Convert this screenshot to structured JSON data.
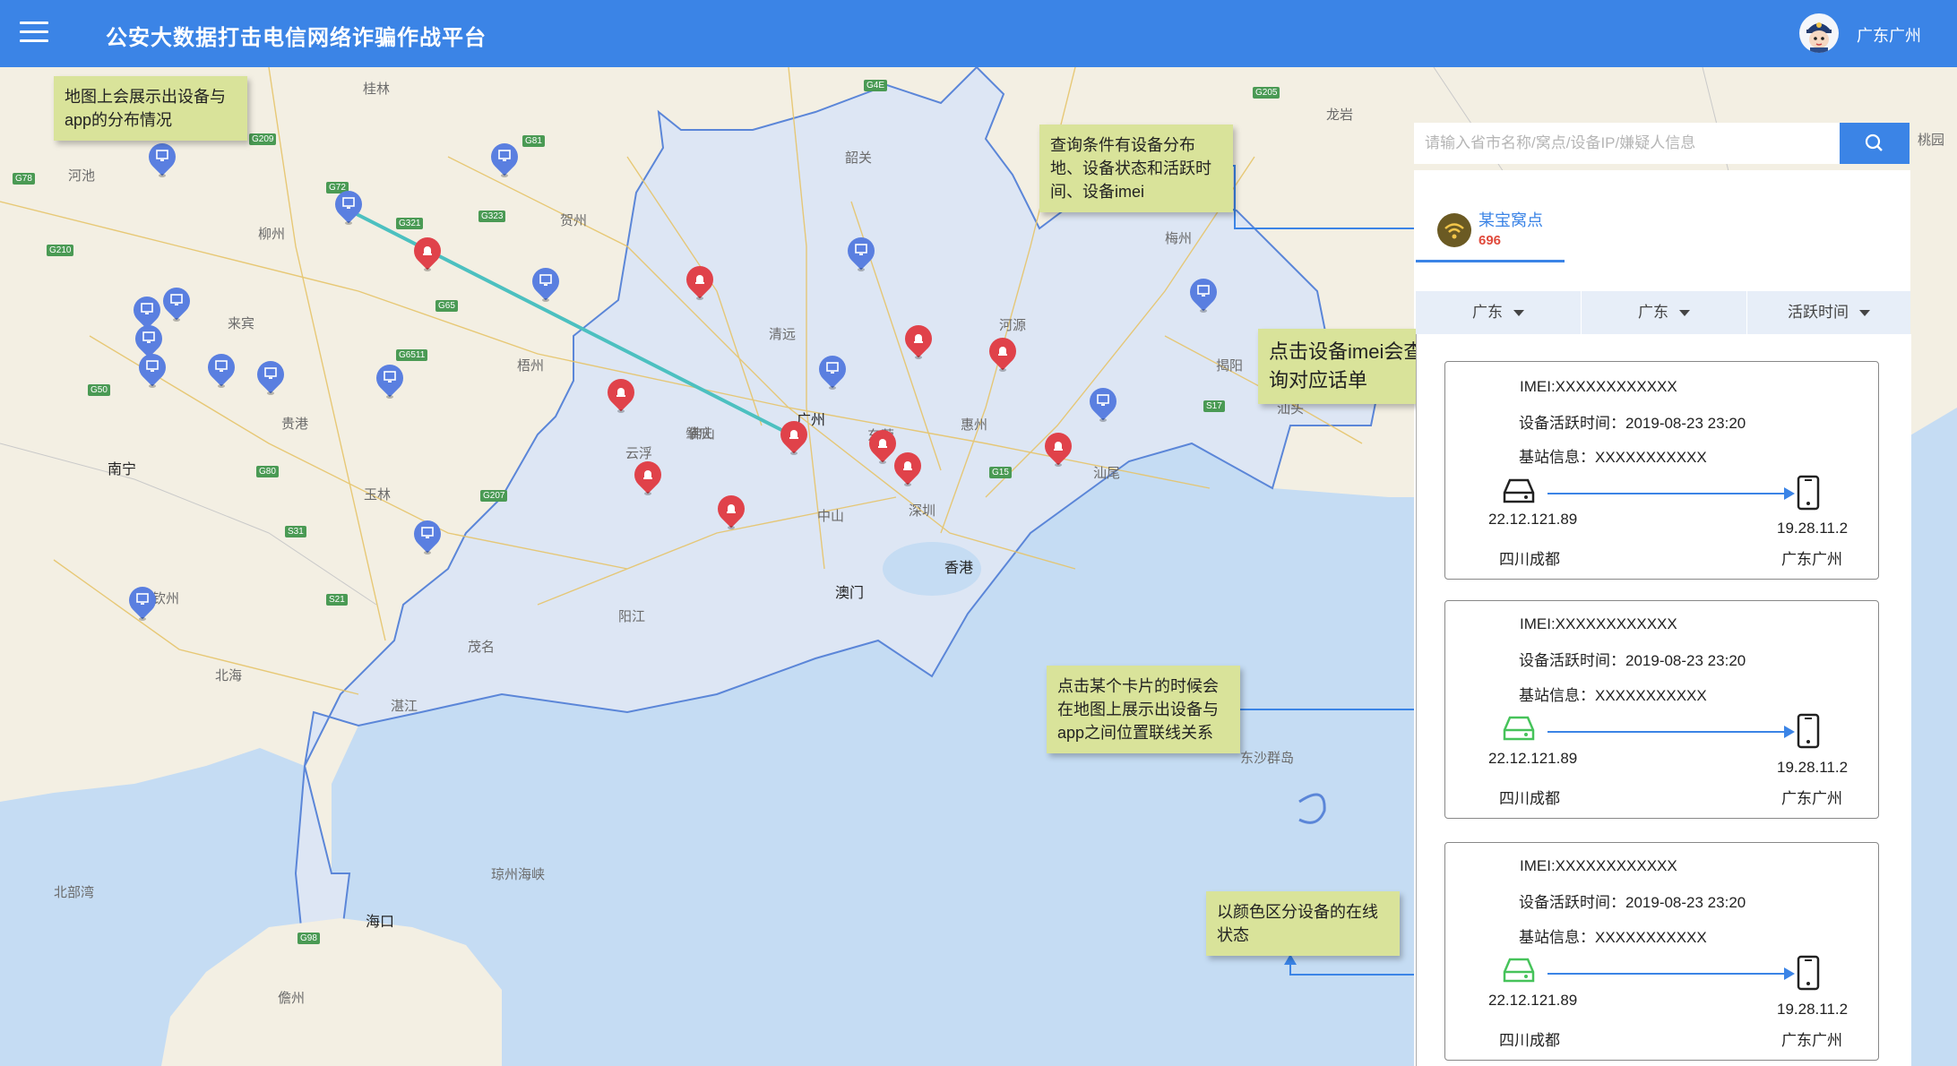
{
  "header": {
    "title": "公安大数据打击电信网络诈骗作战平台",
    "user_region": "广东广州"
  },
  "search": {
    "placeholder": "请输入省市名称/窝点/设备IP/嫌疑人信息"
  },
  "tab": {
    "label": "某宝窝点",
    "count": "696"
  },
  "filters": [
    "广东",
    "广东",
    "活跃时间"
  ],
  "cards": [
    {
      "imei": "IMEI:XXXXXXXXXXXX",
      "active_time": "设备活跃时间：2019-08-23 23:20",
      "base_station": "基站信息：XXXXXXXXXXX",
      "device_ip": "22.12.121.89",
      "device_place": "四川成都",
      "app_ip": "19.28.11.2",
      "app_place": "广东广州",
      "device_status_color": "#222222"
    },
    {
      "imei": "IMEI:XXXXXXXXXXXX",
      "active_time": "设备活跃时间：2019-08-23 23:20",
      "base_station": "基站信息：XXXXXXXXXXX",
      "device_ip": "22.12.121.89",
      "device_place": "四川成都",
      "app_ip": "19.28.11.2",
      "app_place": "广东广州",
      "device_status_color": "#46c35a"
    },
    {
      "imei": "IMEI:XXXXXXXXXXXX",
      "active_time": "设备活跃时间：2019-08-23 23:20",
      "base_station": "基站信息：XXXXXXXXXXX",
      "device_ip": "22.12.121.89",
      "device_place": "四川成都",
      "app_ip": "19.28.11.2",
      "app_place": "广东广州",
      "device_status_color": "#46c35a"
    }
  ],
  "notes": {
    "map_distribution": "地图上会展示出设备与app的分布情况",
    "query_conditions": "查询条件有设备分布地、设备状态和活跃时间、设备imei",
    "click_imei": "点击设备imei会查询对应话单",
    "click_card": "点击某个卡片的时候会在地图上展示出设备与app之间位置联线关系",
    "color_status": "以颜色区分设备的在线状态"
  },
  "map_labels": {
    "cities": [
      "桂林",
      "河池",
      "柳州",
      "贺州",
      "来宾",
      "梧州",
      "贵港",
      "南宁",
      "玉林",
      "钦州",
      "北海",
      "茂名",
      "湛江",
      "阳江",
      "云浮",
      "肇庆",
      "广州",
      "清远",
      "韶关",
      "河源",
      "梅州",
      "惠州",
      "揭阳",
      "汕头",
      "汕尾",
      "龙岩",
      "中山",
      "深圳",
      "东莞",
      "佛山",
      "香港",
      "澳门",
      "东沙群岛",
      "琼州海峡",
      "北部湾",
      "海口",
      "儋州",
      "桃园"
    ],
    "highways": [
      "G72",
      "G78",
      "G210",
      "G209",
      "G323",
      "G321",
      "G65",
      "G81",
      "G4E",
      "G205",
      "G6511",
      "G50",
      "G80",
      "G207",
      "G15",
      "S17",
      "G98",
      "S31",
      "S21"
    ]
  },
  "colors": {
    "primary": "#3b84e6",
    "device_online": "#46c35a",
    "device_offline": "#222222",
    "app_pin": "#5a7fe0",
    "device_pin": "#e0424a",
    "note_bg": "#d9e39a",
    "sea": "#c5dcf3",
    "land": "#f3efe3",
    "guangdong_land": "#dde6f4"
  }
}
